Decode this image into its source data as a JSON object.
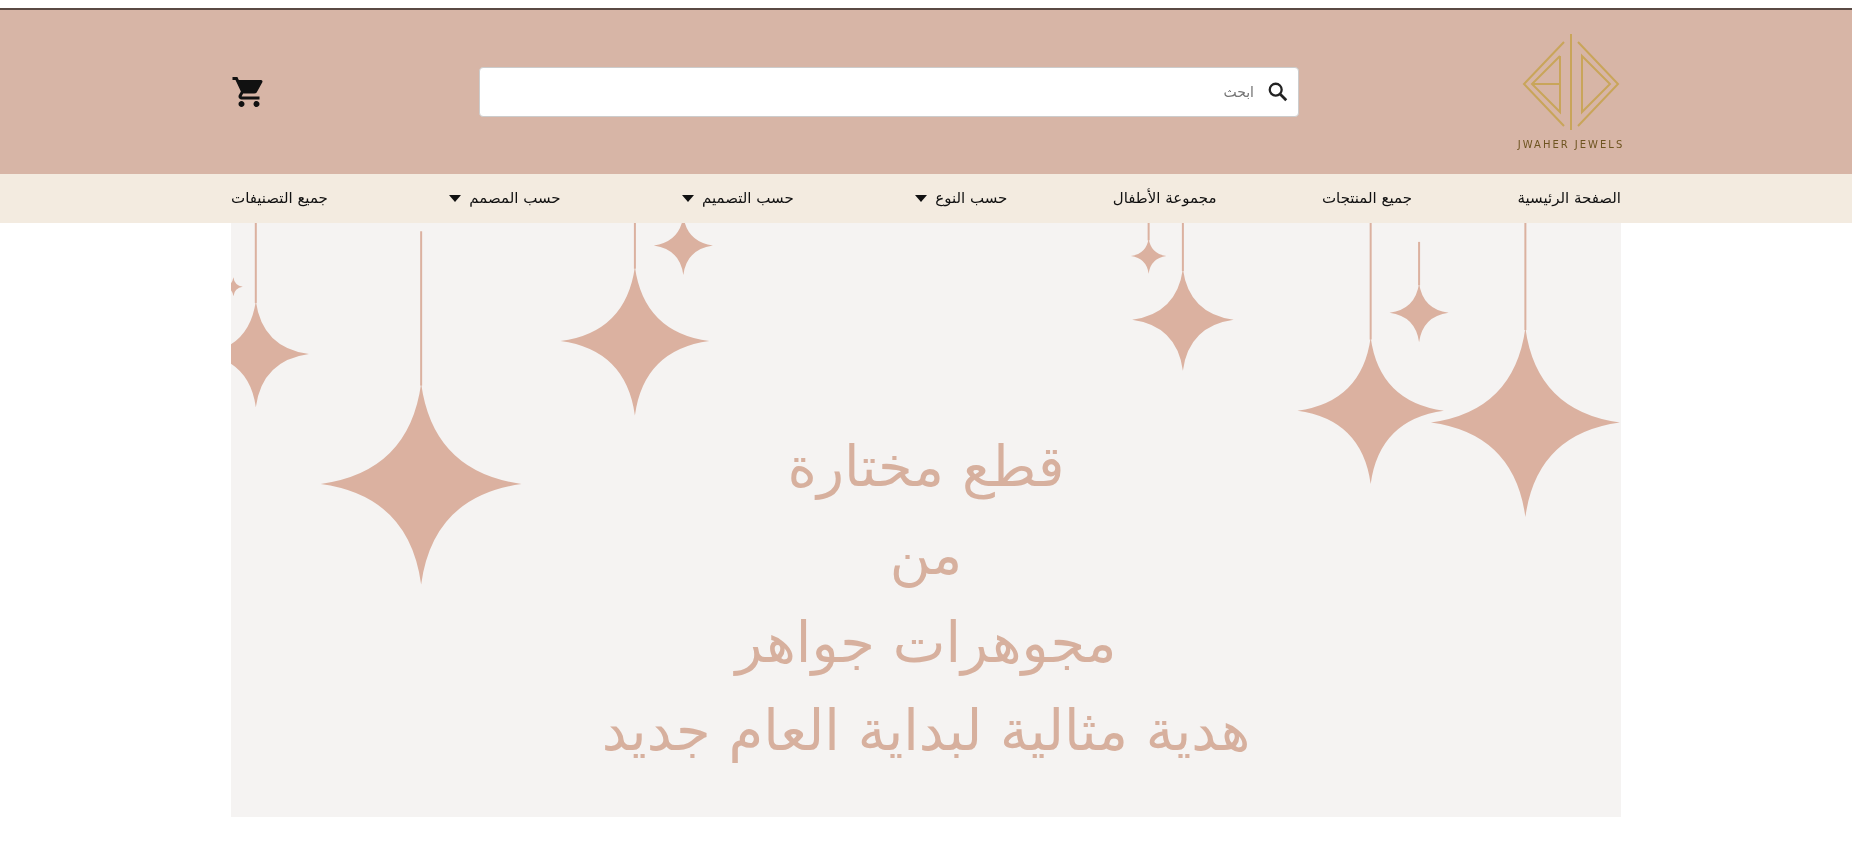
{
  "logo": {
    "text": "JWAHER JEWELS"
  },
  "search": {
    "placeholder": "ابحث"
  },
  "nav": [
    {
      "label": "الصفحة الرئيسية",
      "dropdown": false
    },
    {
      "label": "جميع المنتجات",
      "dropdown": false
    },
    {
      "label": "مجموعة الأطفال",
      "dropdown": false
    },
    {
      "label": "حسب النوع",
      "dropdown": true
    },
    {
      "label": "حسب التصميم",
      "dropdown": true
    },
    {
      "label": "حسب المصمم",
      "dropdown": true
    },
    {
      "label": "جميع التصنيفات",
      "dropdown": false
    }
  ],
  "banner": {
    "lines": [
      "قطع مختارة",
      "من",
      "مجوهرات جواهر",
      "هدية مثالية لبداية العام جديد"
    ]
  }
}
